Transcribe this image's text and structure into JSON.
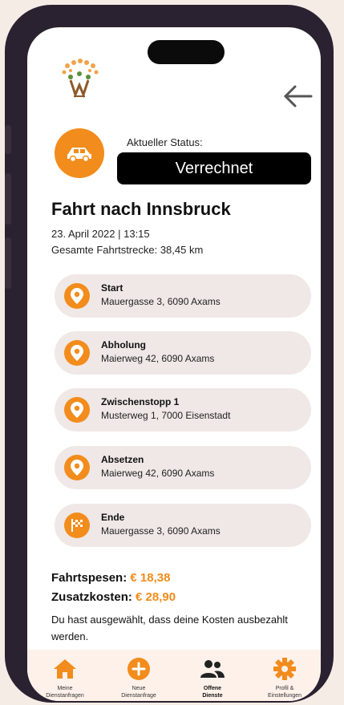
{
  "header": {
    "back_icon": "arrow-left-icon",
    "logo_icon": "tree-people-logo"
  },
  "status": {
    "label": "Aktueller Status:",
    "value": "Verrechnet",
    "icon": "car-icon"
  },
  "trip": {
    "title": "Fahrt nach Innsbruck",
    "date_time": "23. April 2022 | 13:15",
    "distance": "Gesamte Fahrtstrecke: 38,45 km"
  },
  "stops": [
    {
      "name": "Start",
      "address": "Mauergasse 3, 6090 Axams",
      "icon": "map-pin-icon"
    },
    {
      "name": "Abholung",
      "address": "Maierweg 42, 6090 Axams",
      "icon": "map-pin-icon"
    },
    {
      "name": "Zwischenstopp 1",
      "address": "Musterweg 1, 7000 Eisenstadt",
      "icon": "map-pin-icon"
    },
    {
      "name": "Absetzen",
      "address": "Maierweg 42, 6090 Axams",
      "icon": "map-pin-icon"
    },
    {
      "name": "Ende",
      "address": "Mauergasse 3, 6090 Axams",
      "icon": "checkered-flag-icon"
    }
  ],
  "costs": {
    "travel_label": "Fahrtspesen:",
    "travel_amount": "€ 18,38",
    "extra_label": "Zusatzkosten:",
    "extra_amount": "€ 28,90"
  },
  "note": "Du hast ausgewählt, dass deine Kosten ausbezahlt werden.",
  "tabs": [
    {
      "line1": "Meine",
      "line2": "Dienstanfragen",
      "icon": "home-icon",
      "active": false
    },
    {
      "line1": "Neue",
      "line2": "Dienstanfrage",
      "icon": "plus-circle-icon",
      "active": false
    },
    {
      "line1": "Offene",
      "line2": "Dienste",
      "icon": "users-icon",
      "active": true
    },
    {
      "line1": "Profil &",
      "line2": "Einstellungen",
      "icon": "gear-icon",
      "active": false
    }
  ],
  "colors": {
    "accent": "#f28c1c",
    "pill": "#000000",
    "stop_bg": "#efe8e6",
    "tabbar_bg": "#fdf1ea"
  }
}
